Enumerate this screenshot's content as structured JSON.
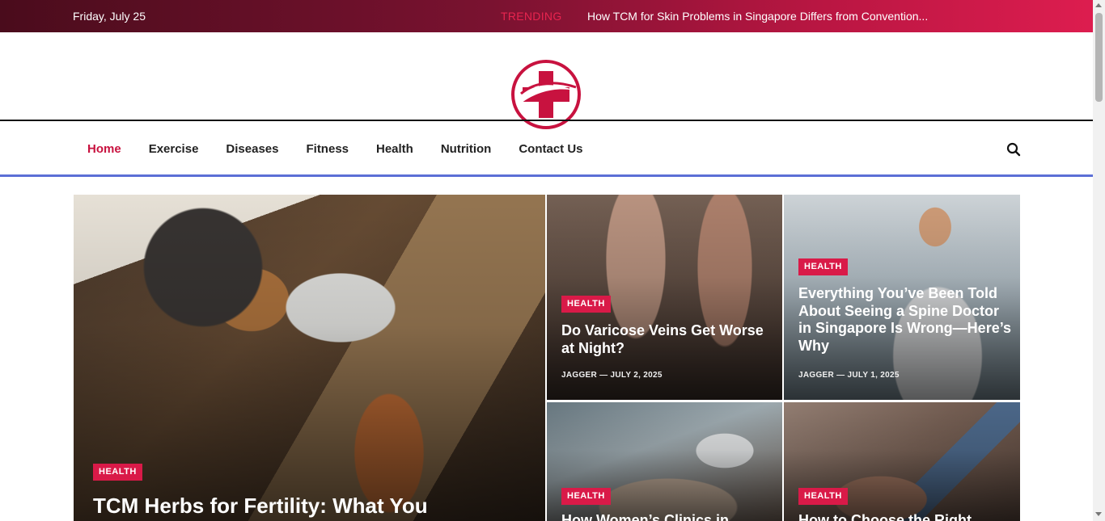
{
  "topbar": {
    "date": "Friday, July 25",
    "trending_label": "TRENDING",
    "trending_title": "How TCM for Skin Problems in Singapore Differs from Convention..."
  },
  "logo": {
    "icon": "medical-cross-logo-icon",
    "color": "#c8123f"
  },
  "nav": {
    "items": [
      {
        "label": "Home",
        "active": true
      },
      {
        "label": "Exercise"
      },
      {
        "label": "Diseases"
      },
      {
        "label": "Fitness"
      },
      {
        "label": "Health"
      },
      {
        "label": "Nutrition"
      },
      {
        "label": "Contact Us"
      }
    ],
    "search_icon": "search-icon"
  },
  "posts": {
    "main": {
      "category": "HEALTH",
      "title": "TCM Herbs for Fertility: What You"
    },
    "a": {
      "category": "HEALTH",
      "title": "Do Varicose Veins Get Worse at Night?",
      "author": "JAGGER",
      "date": "JULY 2, 2025"
    },
    "b": {
      "category": "HEALTH",
      "title": "Everything You’ve Been Told About Seeing a Spine Doctor in Singapore Is Wrong—Here’s Why",
      "author": "JAGGER",
      "date": "JULY 1, 2025"
    },
    "c": {
      "category": "HEALTH",
      "title": "How Women’s Clinics in"
    },
    "d": {
      "category": "HEALTH",
      "title": "How to Choose the Right"
    }
  },
  "colors": {
    "accent": "#c8123f",
    "badge": "#d91a48",
    "nav_underline": "#5b6fd6"
  }
}
